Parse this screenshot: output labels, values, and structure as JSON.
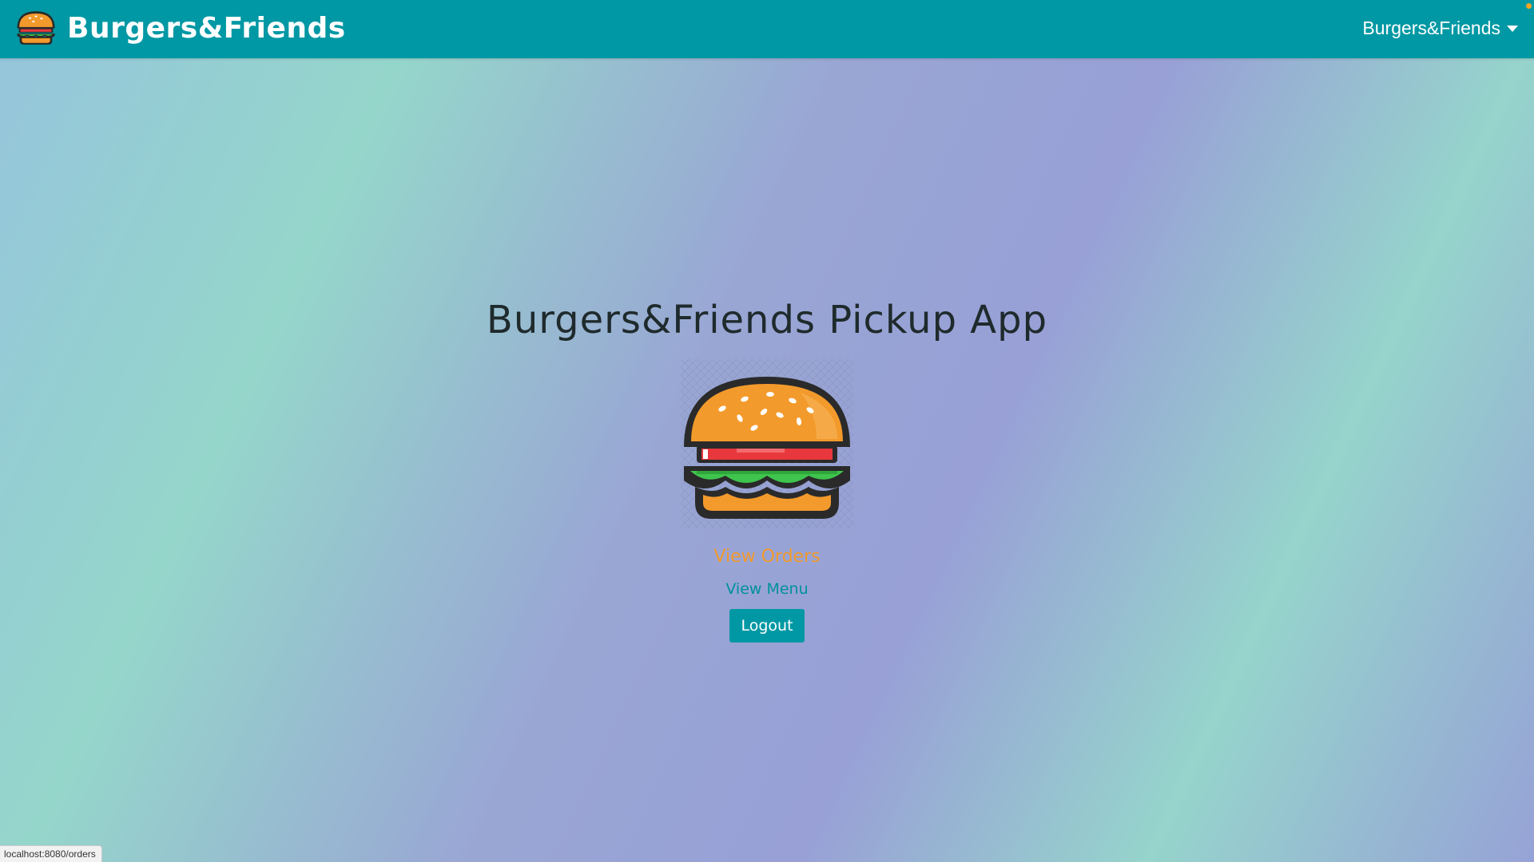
{
  "navbar": {
    "brand_logo_icon": "burger-icon",
    "brand_name": "Burgers&Friends",
    "account_label": "Burgers&Friends",
    "account_caret_icon": "caret-down-icon",
    "background_color": "#0098a4"
  },
  "main": {
    "title": "Burgers&Friends Pickup App",
    "hero_icon": "burger-icon",
    "view_orders_label": "View Orders",
    "view_menu_label": "View Menu",
    "logout_label": "Logout"
  },
  "colors": {
    "accent": "#0098a4",
    "link_highlight": "#f39a2c",
    "link": "#00909c"
  },
  "status_bar": {
    "url": "localhost:8080/orders"
  }
}
